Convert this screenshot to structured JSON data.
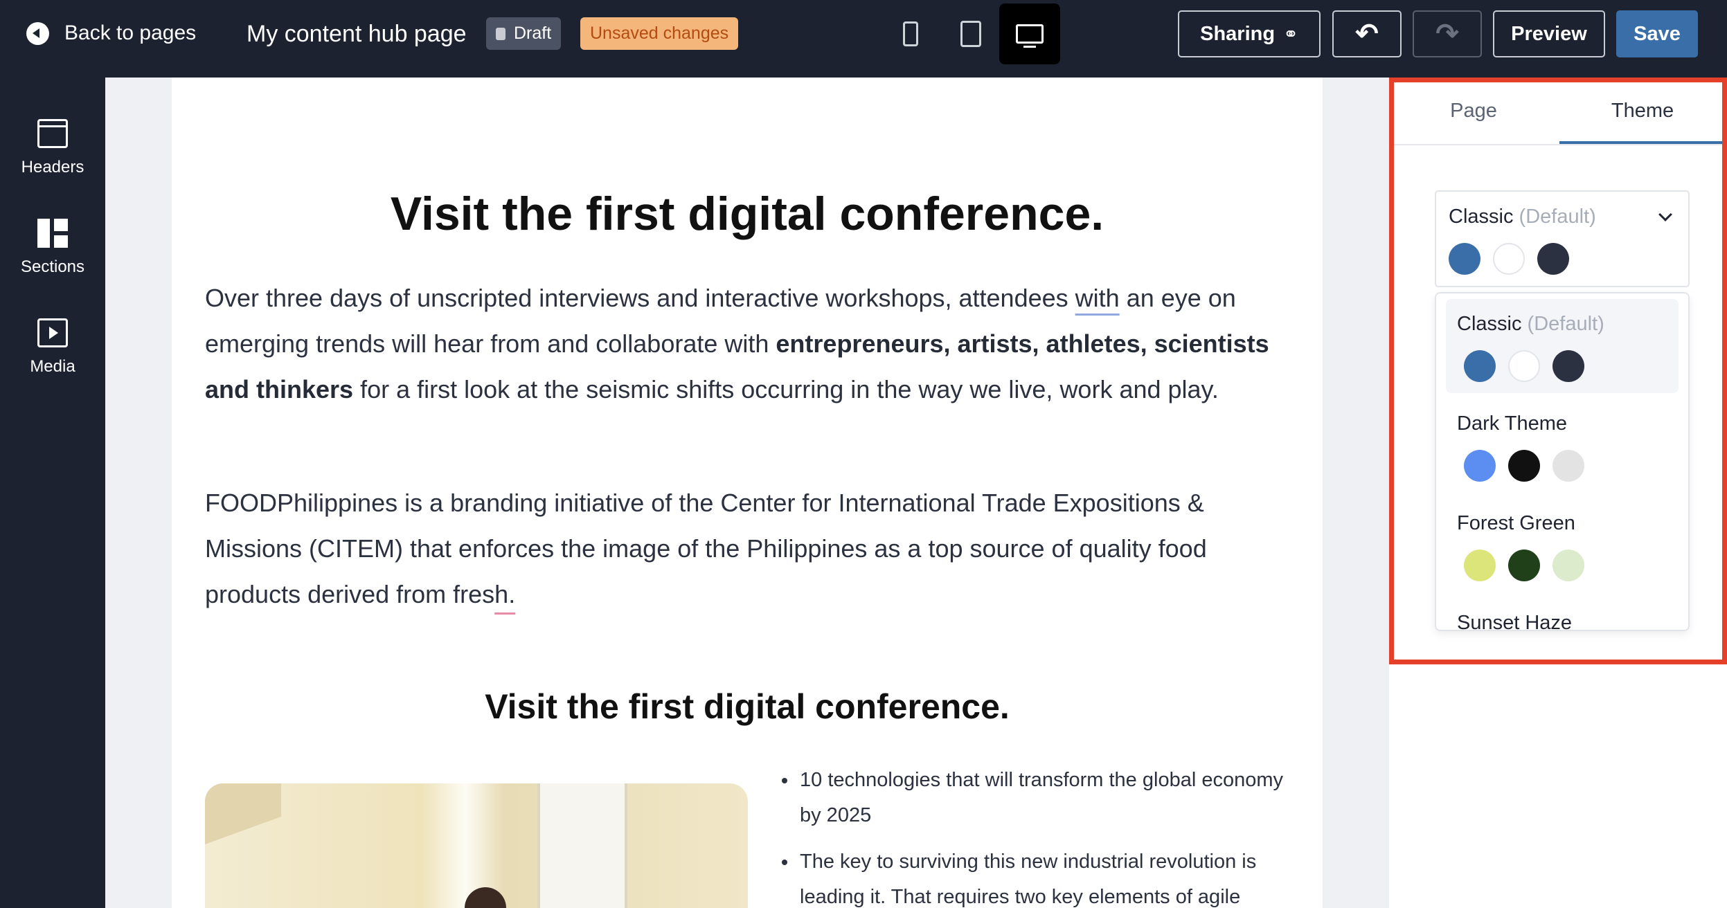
{
  "topbar": {
    "back_label": "Back to pages",
    "page_name": "My content hub page",
    "draft_label": "Draft",
    "unsaved_label": "Unsaved changes",
    "sharing_label": "Sharing",
    "preview_label": "Preview",
    "save_label": "Save",
    "devices": [
      "mobile",
      "tablet",
      "desktop"
    ],
    "active_device": "desktop"
  },
  "sidebar": {
    "items": [
      {
        "label": "Headers",
        "icon": "headers-icon"
      },
      {
        "label": "Sections",
        "icon": "sections-icon"
      },
      {
        "label": "Media",
        "icon": "media-icon"
      }
    ]
  },
  "content": {
    "heading": "Visit the first digital conference.",
    "para1": {
      "before": "Over three days of unscripted interviews and interactive workshops, attendees ",
      "underlined": "with",
      "after": " an eye on emerging trends will hear from and collaborate with ",
      "bold": "entrepreneurs, artists, athletes, scientists and thinkers",
      "end": " for a first look at the seismic shifts occurring in the way we live, work and play."
    },
    "para2": {
      "before": "FOODPhilippines is a branding initiative of the Center for International Trade Expositions & Missions (CITEM) that enforces the image of the Philippines as a top source of quality food products derived from fres",
      "underlined": "h."
    },
    "heading2": "Visit the first digital conference.",
    "bullets": [
      "10 technologies that will transform the global economy by 2025",
      "The key to surviving this new industrial revolution is leading it. That requires two key elements of agile"
    ]
  },
  "panel": {
    "tabs": [
      "Page",
      "Theme"
    ],
    "active_tab": "Theme",
    "selected_theme": {
      "name": "Classic",
      "tag": "(Default)"
    },
    "themes": [
      {
        "name": "Classic",
        "tag": "(Default)",
        "colors": [
          "#3a6ea8",
          "#ffffff",
          "#2b3140"
        ]
      },
      {
        "name": "Dark Theme",
        "tag": "",
        "colors": [
          "#5b8ef0",
          "#111111",
          "#e3e3e3"
        ]
      },
      {
        "name": "Forest Green",
        "tag": "",
        "colors": [
          "#dce57a",
          "#1f4019",
          "#dcebcb"
        ]
      },
      {
        "name": "Sunset Haze",
        "tag": "",
        "colors": []
      }
    ]
  },
  "colors": {
    "topbar_bg": "#1c2230",
    "accent": "#3a6ea8",
    "highlight_border": "#e5402a",
    "unsaved_badge": "#f4b67a"
  }
}
